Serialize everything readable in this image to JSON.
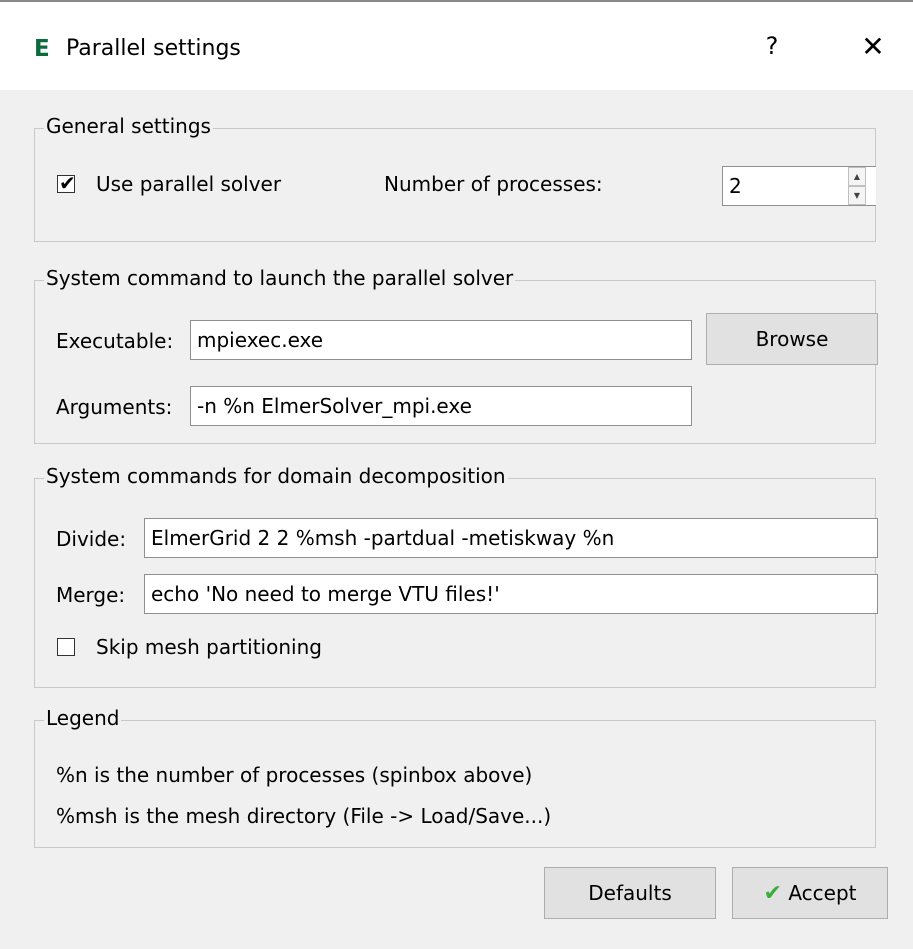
{
  "window": {
    "app_icon_letter": "E",
    "title": "Parallel settings",
    "help_glyph": "?",
    "close_glyph": "✕"
  },
  "general": {
    "title": "General settings",
    "use_parallel_label": "Use parallel solver",
    "use_parallel_checked": true,
    "num_processes_label": "Number of processes:",
    "num_processes_value": "2"
  },
  "launch": {
    "title": "System command to launch the parallel solver",
    "executable_label": "Executable:",
    "executable_value": "mpiexec.exe",
    "browse_label": "Browse",
    "arguments_label": "Arguments:",
    "arguments_value": "-n %n ElmerSolver_mpi.exe"
  },
  "decomposition": {
    "title": "System commands for domain decomposition",
    "divide_label": "Divide:",
    "divide_value": "ElmerGrid 2 2 %msh -partdual -metiskway %n",
    "merge_label": "Merge:",
    "merge_value": "echo 'No need to merge VTU files!'",
    "skip_label": "Skip mesh partitioning",
    "skip_checked": false
  },
  "legend": {
    "title": "Legend",
    "line1": "%n is the number of processes (spinbox above)",
    "line2": "%msh is the mesh directory (File -> Load/Save...)"
  },
  "footer": {
    "defaults_label": "Defaults",
    "accept_label": "Accept",
    "accept_icon": "checkmark-icon"
  },
  "colors": {
    "background": "#f0f0f0",
    "accept_icon": "#3cae3c",
    "app_icon": "#0b6b3a"
  }
}
